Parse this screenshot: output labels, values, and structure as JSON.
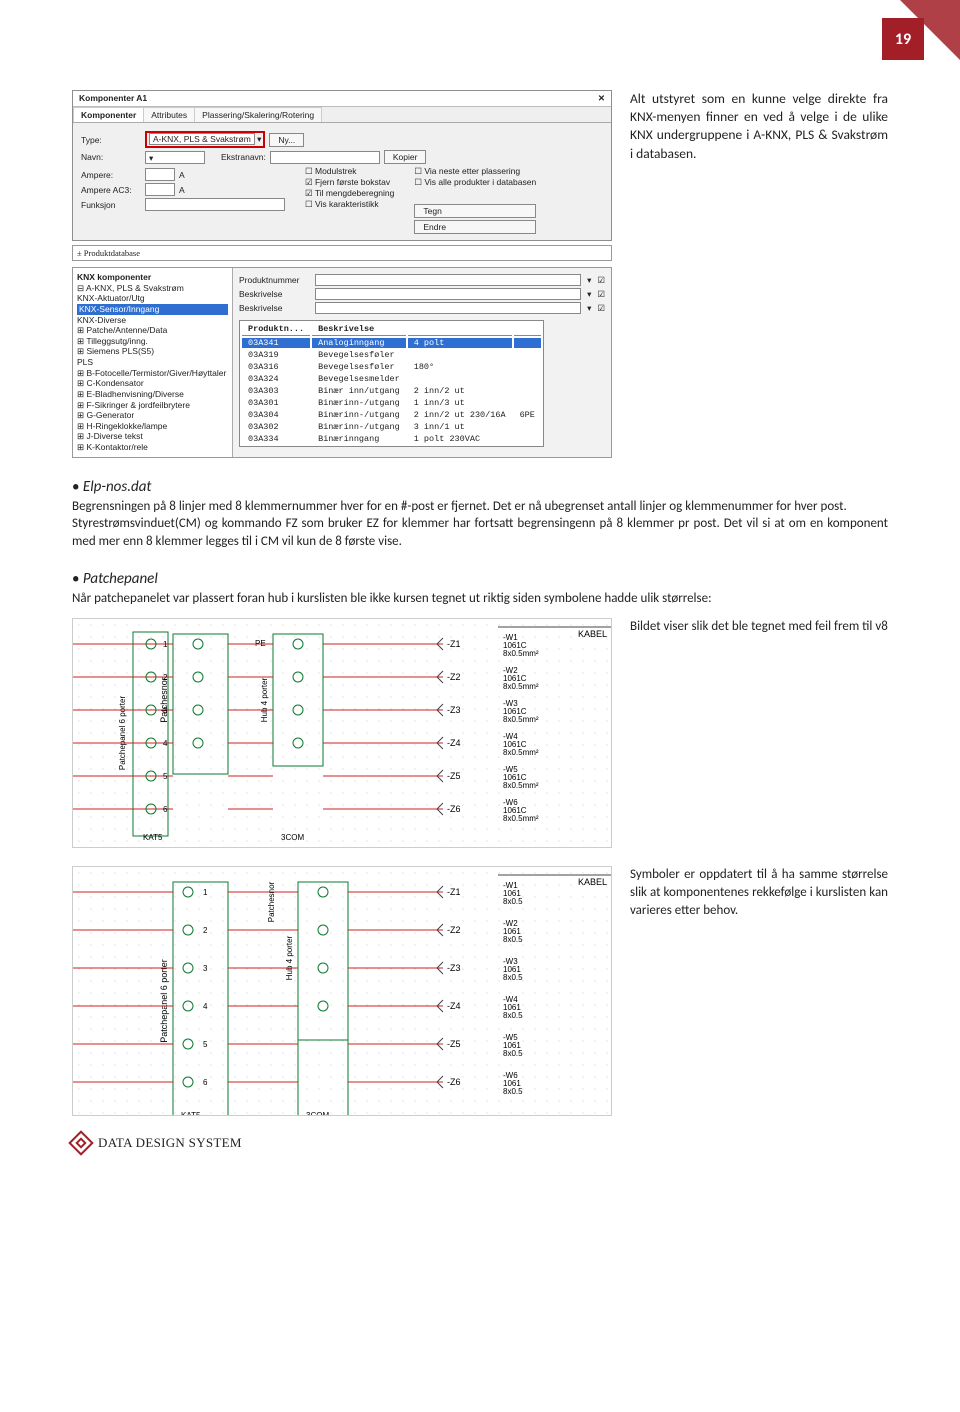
{
  "page_number": "19",
  "top_paragraph": "Alt utstyret som en kunne velge direkte fra KNX-menyen finner en ved å velge i de ulike KNX undergruppene i A-KNX, PLS & Svakstrøm i databasen.",
  "win": {
    "title": "Komponenter A1",
    "tabs": [
      "Komponenter",
      "Attributes",
      "Plassering/Skalering/Rotering"
    ],
    "type_label": "Type:",
    "type_value": "A-KNX, PLS & Svakstrøm",
    "ny_btn": "Ny...",
    "navn_label": "Navn:",
    "ekstranavn_label": "Ekstranavn:",
    "kopier_btn": "Kopier",
    "ampere_label": "Ampere:",
    "ampere_val": "A",
    "ampere_ac3_label": "Ampere AC3:",
    "chk1": "Modulstrek",
    "chk2": "Fjern første bokstav",
    "chk3": "Til mengdeberegning",
    "chk4": "Vis karakteristikk",
    "chk5": "Via neste etter plassering",
    "chk6": "Vis alle produkter i databasen",
    "funksjon_label": "Funksjon",
    "tegn_btn": "Tegn",
    "endre_btn": "Endre"
  },
  "pd": {
    "title_prefix": "±",
    "title": "Produktdatabase",
    "tree_head": "KNX komponenter",
    "tree": [
      "⊟ A-KNX, PLS & Svakstrøm",
      "    KNX-Aktuator/Utg",
      "    KNX-Sensor/Inngang",
      "    KNX-Diverse",
      "  ⊞ Patche/Antenne/Data",
      "  ⊞ Tilleggsutg/inng.",
      "  ⊞ Siemens PLS(S5)",
      "    PLS",
      "⊞ B-Fotocelle/Termistor/Giver/Høyttaler",
      "⊞ C-Kondensator",
      "⊞ E-Bladhenvisning/Diverse",
      "⊞ F-Sikringer & jordfeilbrytere",
      "⊞ G-Generator",
      "⊞ H-Ringeklokke/lampe",
      "⊞ J-Diverse tekst",
      "⊞ K-Kontaktor/rele"
    ],
    "tree_selected_index": 2,
    "search": {
      "l1": "Produktnummer",
      "l2": "Beskrivelse",
      "l3": "Beskrivelse"
    },
    "table_hdr": [
      "Produktn...",
      "Beskrivelse",
      "",
      ""
    ],
    "rows": [
      [
        "03A341",
        "Analoginngang",
        "4 polt",
        ""
      ],
      [
        "03A319",
        "Bevegelsesføler",
        "",
        ""
      ],
      [
        "03A316",
        "Bevegelsesføler",
        "180°",
        ""
      ],
      [
        "03A324",
        "Bevegelsesmelder",
        "",
        ""
      ],
      [
        "03A303",
        "Binær inn/utgang",
        "2 inn/2 ut",
        ""
      ],
      [
        "03A301",
        "Binærinn-/utgang",
        "1 inn/3 ut",
        ""
      ],
      [
        "03A304",
        "Binærinn-/utgang",
        "2 inn/2 ut 230/16A",
        "6PE"
      ],
      [
        "03A302",
        "Binærinn-/utgang",
        "3 inn/1 ut",
        ""
      ],
      [
        "03A334",
        "Binærinngang",
        "1 polt   230VAC",
        ""
      ]
    ],
    "sel_row": 0
  },
  "elp": {
    "heading": "Elp-nos.dat",
    "text": "Begrensningen på 8 linjer med 8 klemmernummer hver for en #-post er fjernet. Det er nå ubegrenset antall linjer og klemmenummer for hver post.\nStyrestrømsvinduet(CM) og kommando FZ som bruker EZ for klemmer har fortsatt begrensingenn på 8 klemmer pr post. Det vil si at om en komponent med mer enn 8 klemmer legges til i CM vil kun de 8 første vise."
  },
  "patch": {
    "heading": "Patchepanel",
    "intro": "Når patchepanelet var plassert foran hub i kurslisten ble ikke kursen tegnet ut riktig siden symbolene hadde ulik størrelse:",
    "caption1": "Bildet viser slik det ble tegnet med feil frem til v8",
    "caption2": "Symboler er oppdatert til å ha samme størrelse slik at komponentenes rekkefølge i kurslisten kan varieres etter behov."
  },
  "diagram_common": {
    "kabel_head": "KABEL",
    "left_box": "Patchepanel 6 porter",
    "right_box": "Hub 4 porter",
    "pe": "PE",
    "kat5": "KAT5",
    "com": "3COM",
    "z_labels": [
      "-Z1",
      "-Z2",
      "-Z3",
      "-Z4",
      "-Z5",
      "-Z6"
    ],
    "cables1": [
      "-W1 1061C 8x0.5mm²",
      "-W2 1061C 8x0.5mm²",
      "-W3 1061C 8x0.5mm²",
      "-W4 1061C 8x0.5mm²",
      "-W5 1061C 8x0.5mm²",
      "-W6 1061C 8x0.5mm²"
    ],
    "cables2": [
      "-W1 1061 8x0.5",
      "-W2 1061 8x0.5",
      "-W3 1061 8x0.5",
      "-W4 1061 8x0.5",
      "-W5 1061 8x0.5",
      "-W6 1061 8x0.5"
    ],
    "ports": [
      "1",
      "2",
      "3",
      "4",
      "5",
      "6"
    ]
  },
  "footer": "DATA DESIGN SYSTEM"
}
